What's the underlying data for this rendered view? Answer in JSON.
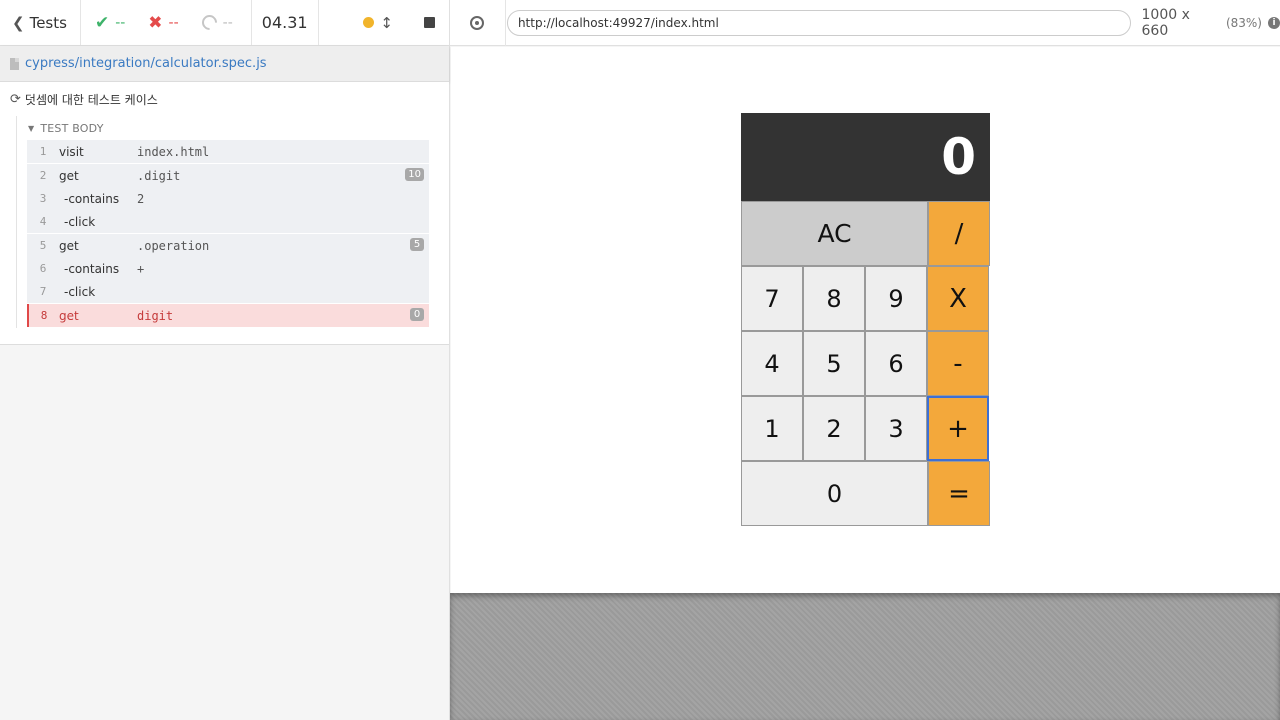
{
  "reporter": {
    "tests_label": "Tests",
    "passed": "--",
    "failed": "--",
    "pending": "--",
    "duration": "04.31",
    "spec_path": "cypress/integration/calculator.spec.js",
    "suite_title": "덧셈에 대한 테스트 케이스",
    "body_title": "TEST BODY",
    "commands": [
      {
        "num": "1",
        "name": "visit",
        "msg": "index.html",
        "badge": ""
      },
      {
        "num": "2",
        "name": "get",
        "msg": ".digit",
        "badge": "10"
      },
      {
        "num": "3",
        "name": "-contains",
        "msg": "2",
        "badge": ""
      },
      {
        "num": "4",
        "name": "-click",
        "msg": "",
        "badge": ""
      },
      {
        "num": "5",
        "name": "get",
        "msg": ".operation",
        "badge": "5"
      },
      {
        "num": "6",
        "name": "-contains",
        "msg": "+",
        "badge": ""
      },
      {
        "num": "7",
        "name": "-click",
        "msg": "",
        "badge": ""
      },
      {
        "num": "8",
        "name": "get",
        "msg": "digit",
        "badge": "0",
        "state": "failed"
      }
    ],
    "colors": {
      "passed": "#3eb36a",
      "failed": "#e44b4b",
      "running_dot": "#f1b42b",
      "link": "#3a7ac2"
    }
  },
  "aut": {
    "url": "http://localhost:49927/index.html",
    "viewport": "1000 x 660",
    "scale": "(83%)"
  },
  "calculator": {
    "display": "0",
    "keys": {
      "ac": "AC",
      "divide": "/",
      "d7": "7",
      "d8": "8",
      "d9": "9",
      "multiply": "X",
      "d4": "4",
      "d5": "5",
      "d6": "6",
      "subtract": "-",
      "d1": "1",
      "d2": "2",
      "d3": "3",
      "add": "+",
      "d0": "0",
      "equals": "="
    },
    "colors": {
      "display_bg": "#333333",
      "operator": "#f3a83b",
      "digit": "#eeeeee",
      "ac": "#cccccc"
    }
  }
}
